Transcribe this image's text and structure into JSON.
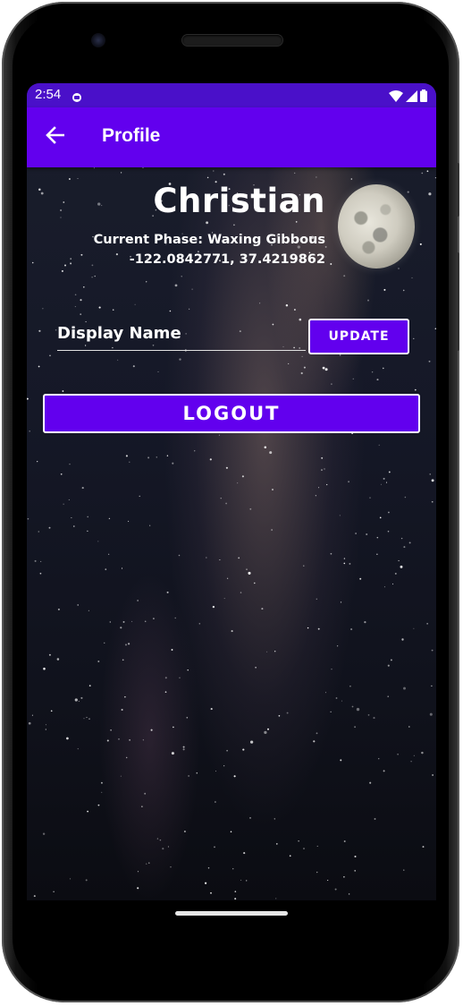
{
  "status_bar": {
    "time": "2:54",
    "icons": [
      "notification-icon",
      "wifi-icon",
      "cell-signal-icon",
      "battery-icon"
    ]
  },
  "app_bar": {
    "title": "Profile",
    "back_icon": "arrow-back-icon",
    "color": "#6200ee"
  },
  "profile": {
    "name": "Christian",
    "phase": "Current Phase: Waxing Gibbous",
    "coordinates": "-122.0842771, 37.4219862",
    "moon_icon": "moon-image"
  },
  "form": {
    "display_name_placeholder": "Display Name",
    "display_name_value": "",
    "update_label": "UPDATE"
  },
  "actions": {
    "logout_label": "LOGOUT"
  },
  "colors": {
    "accent": "#6200ee",
    "status_bar": "#4a10c9",
    "text": "#ffffff"
  }
}
